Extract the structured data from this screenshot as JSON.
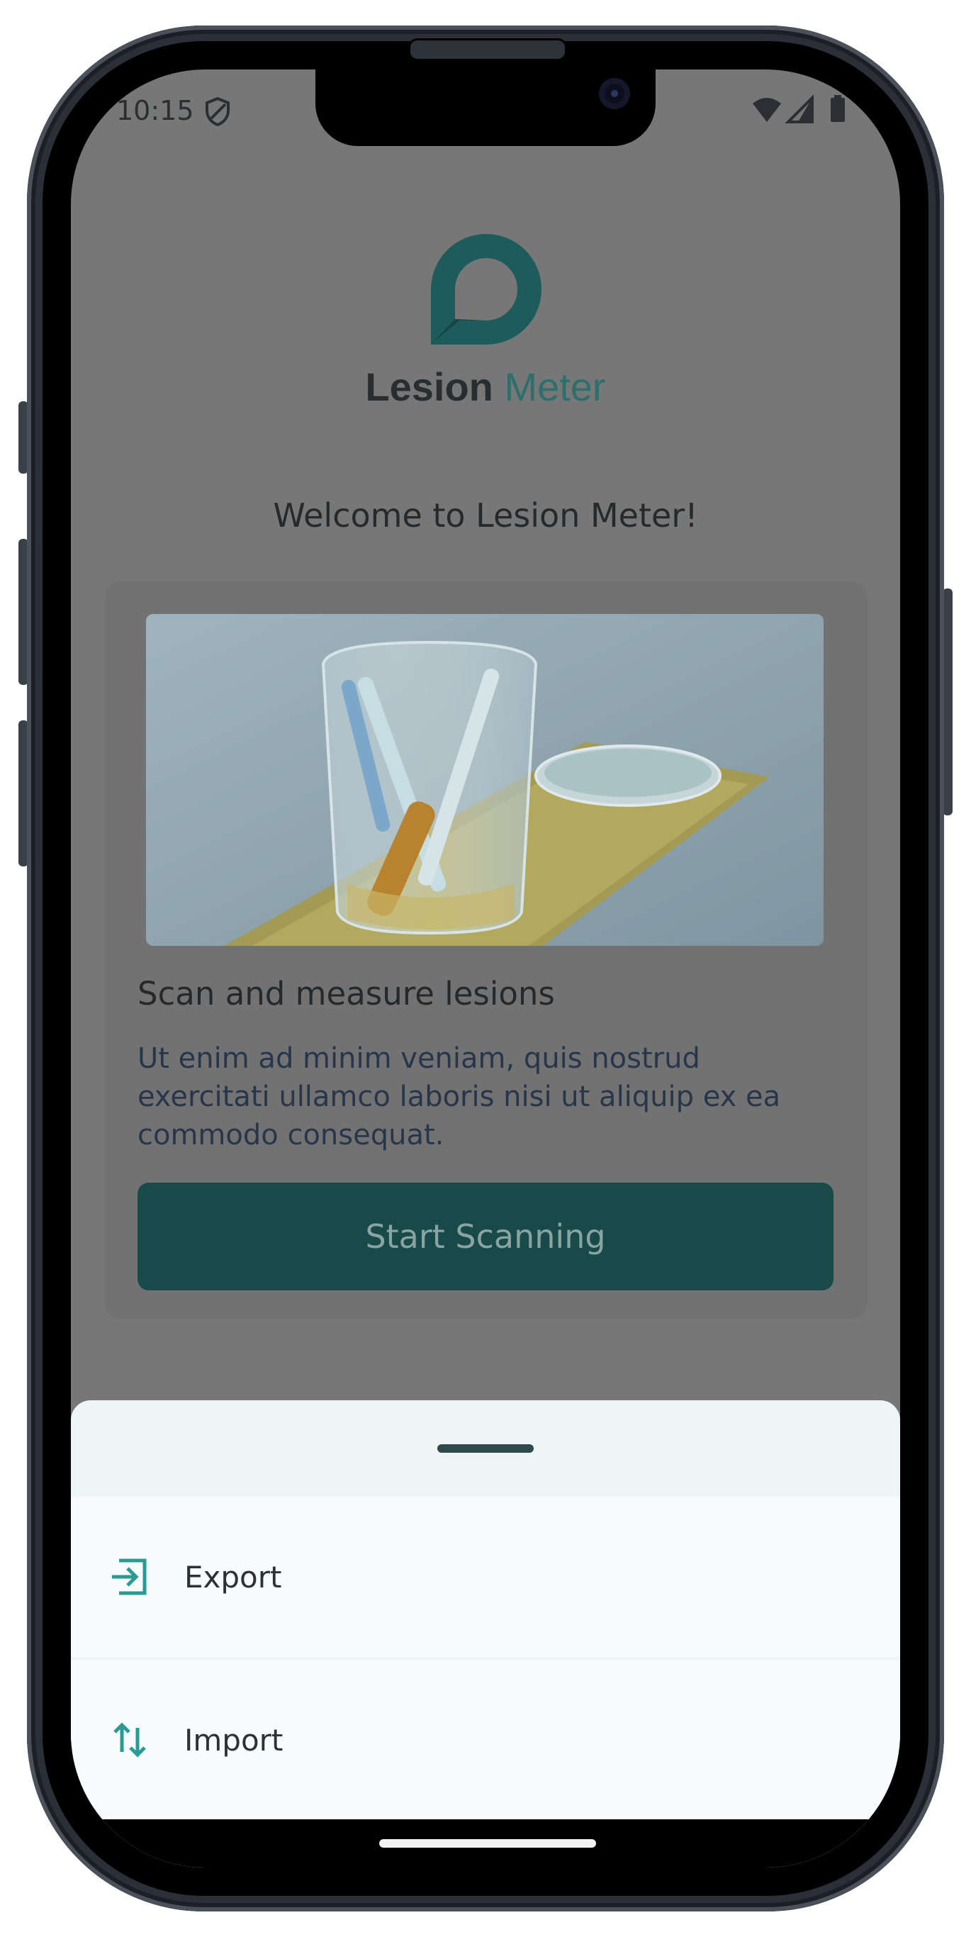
{
  "status_bar": {
    "time": "10:15"
  },
  "brand": {
    "name_bold": "Lesion",
    "name_light": "Meter"
  },
  "welcome": "Welcome to Lesion Meter!",
  "card": {
    "title": "Scan and measure lesions",
    "description": "Ut enim ad minim veniam, quis nostrud exercitati ullamco laboris nisi ut aliquip ex ea commodo consequat.",
    "button_label": "Start Scanning"
  },
  "sheet": {
    "items": [
      {
        "label": "Export",
        "icon": "export-icon"
      },
      {
        "label": "Import",
        "icon": "import-arrows-icon"
      }
    ]
  },
  "colors": {
    "accent": "#2a9a95",
    "button": "#194a4a",
    "scrim": "#777777",
    "sheet_bg": "#eef5f5"
  }
}
